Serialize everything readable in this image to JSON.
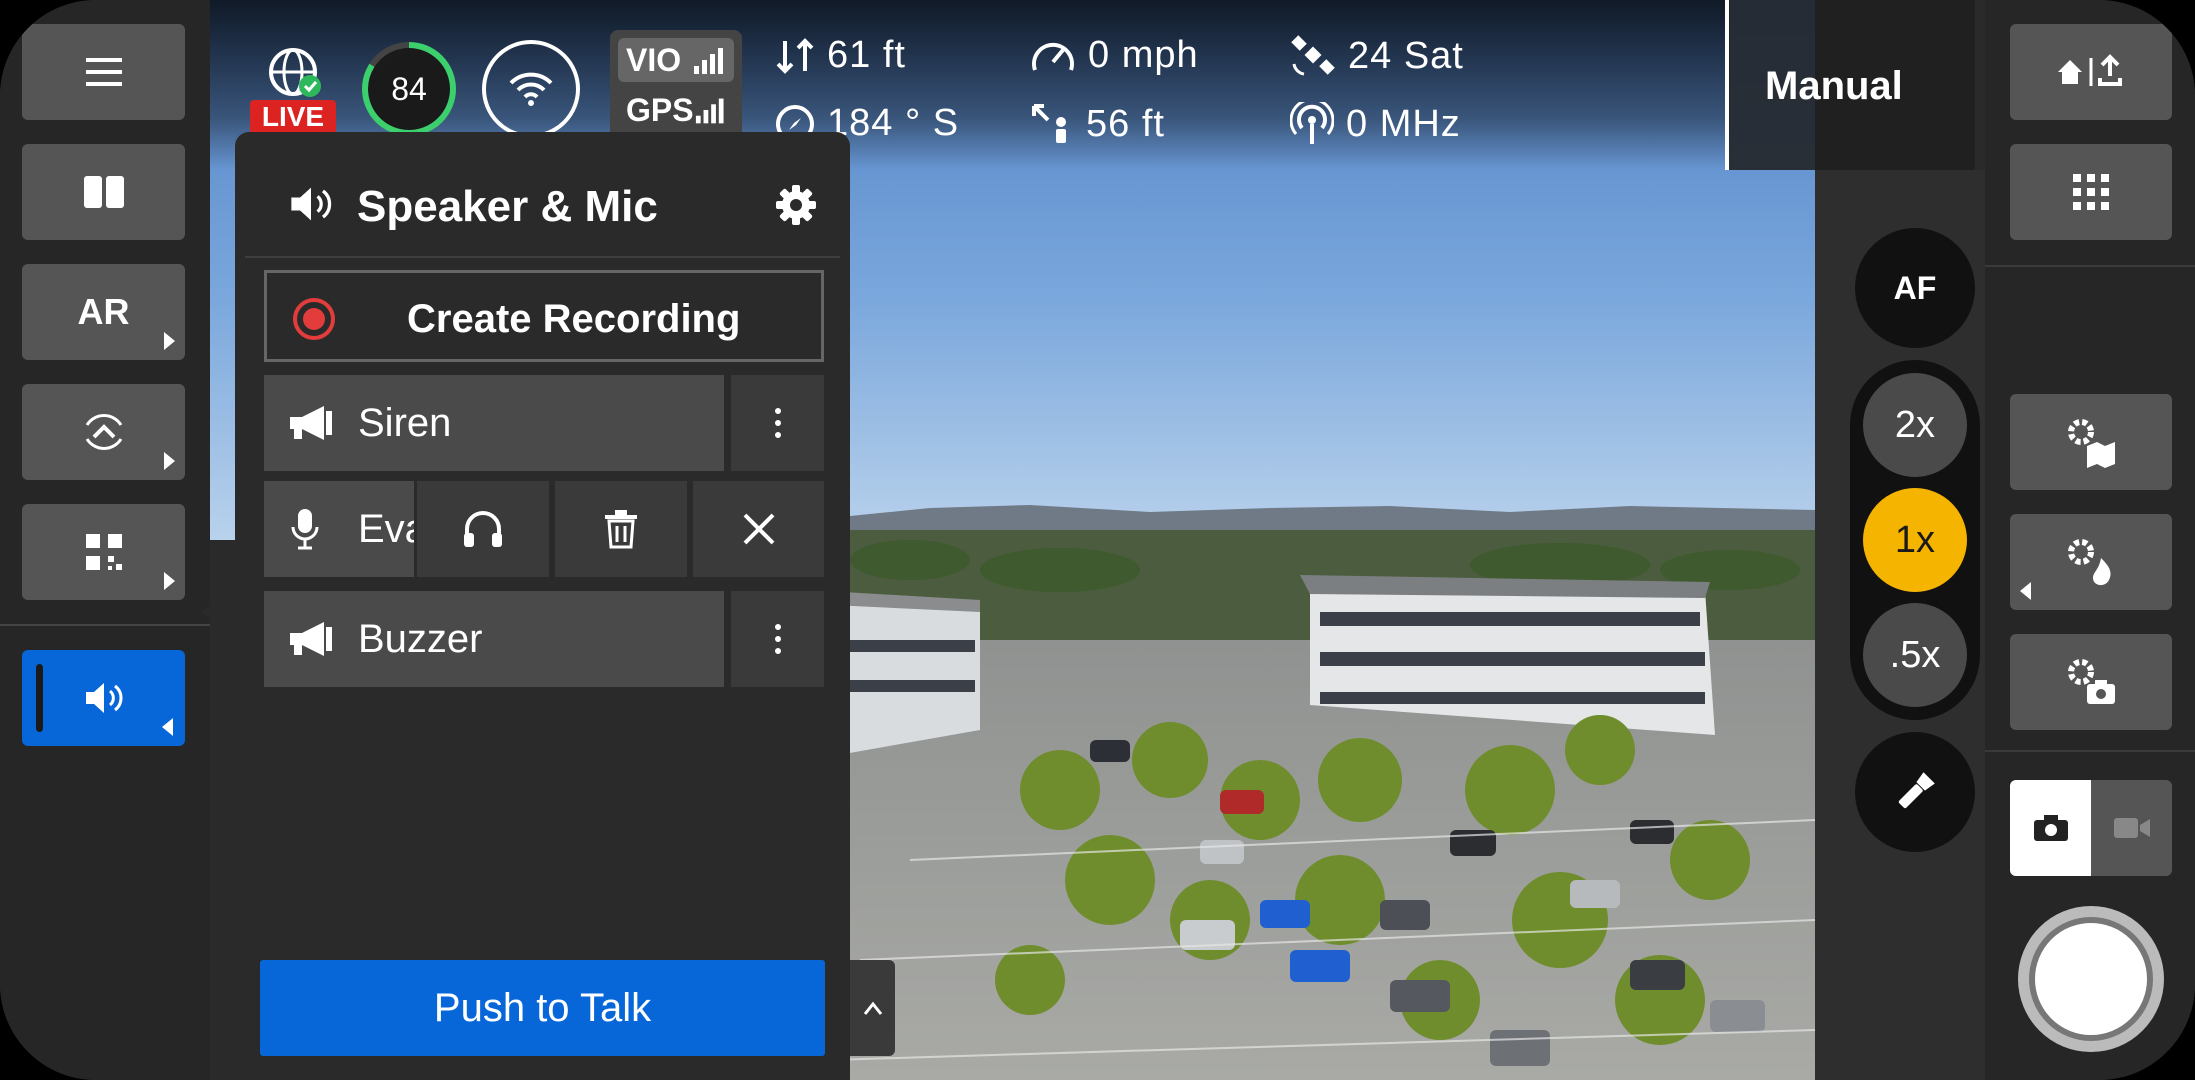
{
  "status": {
    "live_label": "LIVE",
    "battery": "84",
    "vio_label": "VIO",
    "gps_label": "GPS"
  },
  "telemetry": {
    "altitude": "61 ft",
    "speed": "0 mph",
    "satellites": "24 Sat",
    "heading": "184 ° S",
    "distance": "56 ft",
    "frequency": "0 MHz"
  },
  "mode": {
    "label": "Manual"
  },
  "left_rail": {
    "ar_label": "AR",
    "icons": [
      "menu-icon",
      "split-view-icon",
      "ar-icon",
      "obstacle-avoidance-icon",
      "qr-code-icon",
      "speaker-icon"
    ]
  },
  "panel": {
    "title": "Speaker & Mic",
    "create_recording": "Create Recording",
    "clips": [
      {
        "name": "Siren",
        "type": "megaphone"
      },
      {
        "name": "Eva",
        "type": "microphone"
      },
      {
        "name": "Buzzer",
        "type": "megaphone"
      }
    ],
    "push_to_talk": "Push to Talk"
  },
  "zoom": {
    "af_label": "AF",
    "levels": [
      "2x",
      "1x",
      ".5x"
    ],
    "active": "1x"
  },
  "colors": {
    "accent_blue": "#0766d8",
    "zoom_active": "#f5b400",
    "record_red": "#e23c3c",
    "live_red": "#dd2222",
    "battery_green": "#3ccf6e"
  }
}
